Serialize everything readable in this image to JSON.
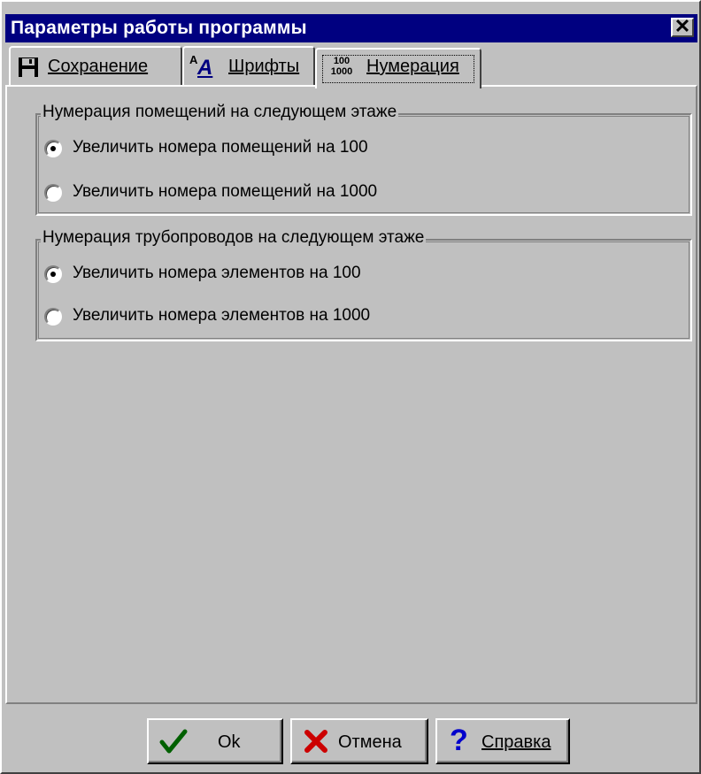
{
  "window": {
    "title": "Параметры работы программы",
    "close_glyph": "✕"
  },
  "tabs": [
    {
      "label": "Сохранение",
      "icon": "floppy-disk-icon"
    },
    {
      "label": "Шрифты",
      "icon": "font-icon",
      "icon_text": "A"
    },
    {
      "label": "Нумерация",
      "icon": "numbering-icon",
      "icon_top": "100",
      "icon_bottom": "1000",
      "active": true
    }
  ],
  "groups": {
    "rooms": {
      "title": "Нумерация помещений на следующем этаже",
      "options": [
        {
          "label": "Увеличить номера помещений на 100",
          "selected": true
        },
        {
          "label": "Увеличить номера помещений на 1000",
          "selected": false
        }
      ]
    },
    "pipes": {
      "title": "Нумерация трубопроводов на следующем этаже",
      "options": [
        {
          "label": "Увеличить номера элементов на 100",
          "selected": true
        },
        {
          "label": "Увеличить номера элементов на 1000",
          "selected": false
        }
      ]
    }
  },
  "buttons": {
    "ok": "Ok",
    "cancel": "Отмена",
    "help": "Справка",
    "help_glyph": "?"
  },
  "colors": {
    "titlebar": "#000080",
    "face": "#c0c0c0",
    "ok_check": "#006000",
    "cancel_x": "#cc0000",
    "help_q": "#0000cc"
  }
}
